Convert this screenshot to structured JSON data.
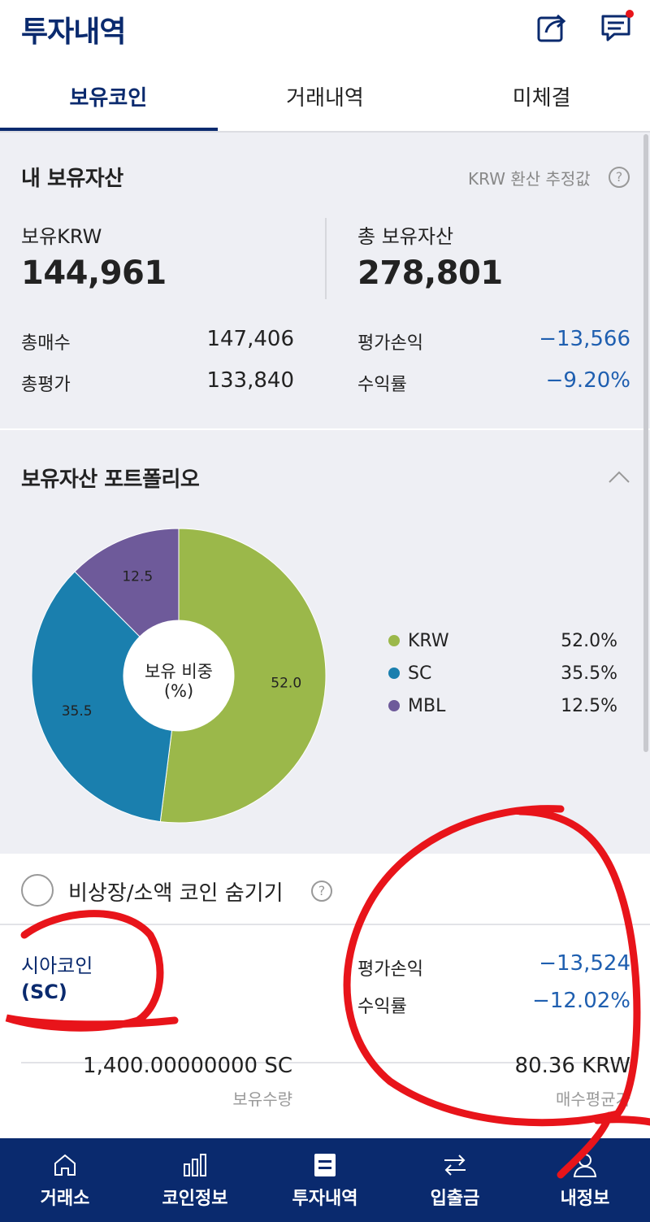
{
  "header": {
    "title": "투자내역"
  },
  "tabs": [
    {
      "label": "보유코인"
    },
    {
      "label": "거래내역"
    },
    {
      "label": "미체결"
    }
  ],
  "assets": {
    "title": "내 보유자산",
    "krw_note": "KRW 환산 추정값",
    "help_glyph": "?",
    "krw_label": "보유KRW",
    "krw_value": "144,961",
    "total_label": "총 보유자산",
    "total_value": "278,801",
    "rows": [
      {
        "label": "총매수",
        "value": "147,406"
      },
      {
        "label": "총평가",
        "value": "133,840"
      },
      {
        "label": "평가손익",
        "value": "−13,566"
      },
      {
        "label": "수익률",
        "value": "−9.20%"
      }
    ]
  },
  "portfolio": {
    "title": "보유자산 포트폴리오",
    "center_line1": "보유 비중",
    "center_line2": "(%)"
  },
  "chart_data": {
    "type": "pie",
    "categories": [
      "KRW",
      "SC",
      "MBL"
    ],
    "values": [
      52.0,
      35.5,
      12.5
    ],
    "slice_labels": [
      "52.0",
      "35.5",
      "12.5"
    ],
    "legend_values": [
      "52.0%",
      "35.5%",
      "12.5%"
    ],
    "colors": [
      "#9bb84a",
      "#1a7fae",
      "#6e5a9a"
    ],
    "legend": "right"
  },
  "holdings": {
    "hide_label": "비상장/소액 코인 숨기기",
    "help_glyph": "?",
    "coin": {
      "name": "시아코인",
      "code": "(SC)",
      "pnl_label": "평가손익",
      "pnl_value": "−13,524",
      "rate_label": "수익률",
      "rate_value": "−12.02%",
      "qty_value": "1,400.00000000 SC",
      "qty_label": "보유수량",
      "avg_value": "80.36  KRW",
      "avg_label": "매수평균가"
    }
  },
  "nav": [
    {
      "label": "거래소",
      "icon": "home-icon"
    },
    {
      "label": "코인정보",
      "icon": "bar-chart-icon"
    },
    {
      "label": "투자내역",
      "icon": "list-icon"
    },
    {
      "label": "입출금",
      "icon": "transfer-icon"
    },
    {
      "label": "내정보",
      "icon": "user-icon"
    }
  ],
  "colors": {
    "brand": "#0a2a6e",
    "negative": "#1f5fb0",
    "annotation": "#e8141a"
  }
}
